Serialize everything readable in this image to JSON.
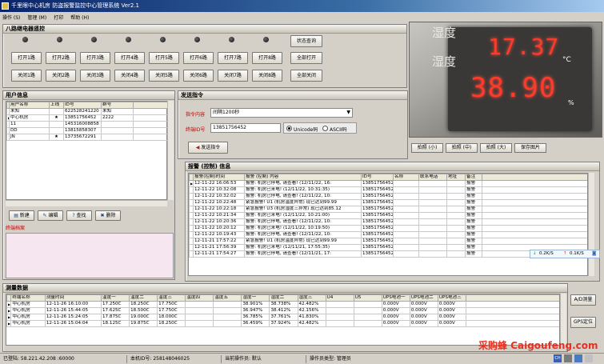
{
  "window": {
    "title": "千里眼中心机房 防盗报警监控中心管理系统 Ver2.1"
  },
  "menu": [
    "操作 (S)",
    "管理 (M)",
    "打印",
    "帮助 (H)"
  ],
  "relay": {
    "title": "八路继电器遥控",
    "open_buttons": [
      "打开1路",
      "打开2路",
      "打开3路",
      "打开4路",
      "打开5路",
      "打开6路",
      "打开7路",
      "打开8路"
    ],
    "close_buttons": [
      "关闭1路",
      "关闭2路",
      "关闭3路",
      "关闭4路",
      "关闭5路",
      "关闭6路",
      "关闭7路",
      "关闭8路"
    ],
    "status_query": "状态查询",
    "open_all": "全部打开",
    "close_all": "全部关闭"
  },
  "camera": {
    "screen_label_1": "湿度",
    "screen_label_2": "湿度",
    "value_1": "17.37",
    "unit_1": "°C",
    "value_2": "38.90",
    "unit_2": "%",
    "buttons": [
      "拍照 (小)",
      "拍照 (中)",
      "拍照 (大)",
      "保存图片"
    ]
  },
  "users": {
    "title": "用户信息",
    "columns": [
      "用户名称",
      "上线",
      "ID号",
      "群号"
    ],
    "rows": [
      [
        "未知",
        "",
        "622528241220",
        "未知"
      ],
      [
        "中心机房",
        "★",
        "13851756452",
        "2222"
      ],
      [
        "11",
        "",
        "145316008858",
        ""
      ],
      [
        "DD",
        "",
        "13815858307",
        ""
      ],
      [
        "JN",
        "★",
        "13735672291",
        ""
      ]
    ],
    "buttons": [
      "新建",
      "编辑",
      "查找",
      "删除"
    ],
    "archive_label": "终端档案"
  },
  "send": {
    "title": "发送指令",
    "cmd_label": "指令内容",
    "cmd_value": "间隔1200秒",
    "terminal_label": "终端ID号",
    "terminal_value": "13851756452",
    "radio_unicode": "Unicode码",
    "radio_ascii": "ASCII码",
    "send_button": "发送指令"
  },
  "alarms": {
    "title": "报警 (控制) 信息",
    "columns": [
      "报警(控制)时间",
      "报警 (控制) 内容",
      "ID号",
      "名称",
      "联系电话",
      "地址",
      "备注"
    ],
    "rows": [
      [
        "12-11-22 16:06:53",
        "报警: 机房已停电, 请查看!   (12/11/22, 16:",
        "13851756452",
        "",
        "",
        "",
        "报警"
      ],
      [
        "12-11-22 10:32:08",
        "报警: 机房已来电!    (12/11/22, 10:31:35)",
        "13851756452",
        "",
        "",
        "",
        "报警"
      ],
      [
        "12-11-22 10:32:02",
        "报警: 机房已停电, 请查看!   (12/11/22, 10:",
        "13851756452",
        "",
        "",
        "",
        "报警"
      ],
      [
        "12-11-22 10:22:48",
        "紧急报警! U1 (机房温度异常) 现已达到99.99",
        "13851756452",
        "",
        "",
        "",
        "报警"
      ],
      [
        "12-11-22 10:22:18",
        "紧急报警! U3 (机房湿度三异常) 现已达到85.12",
        "13851756452",
        "",
        "",
        "",
        "报警"
      ],
      [
        "12-11-22 10:21:34",
        "报警: 机房已来电!    (12/11/22, 10:21:00)",
        "13851756452",
        "",
        "",
        "",
        "报警"
      ],
      [
        "12-11-22 10:20:36",
        "报警: 机房已停电, 请查看!   (12/11/22, 10:",
        "13851756452",
        "",
        "",
        "",
        "报警"
      ],
      [
        "12-11-22 10:20:12",
        "报警: 机房已来电!    (12/11/22, 10:19:50)",
        "13851756452",
        "",
        "",
        "",
        "报警"
      ],
      [
        "12-11-22 10:19:43",
        "报警: 机房已停电, 请查看!   (12/11/22, 10:",
        "13851756452",
        "",
        "",
        "",
        "报警"
      ],
      [
        "12-11-21 17:57:22",
        "紧急报警! U1 (机房温度异常) 现已达到99.99",
        "13851756452",
        "",
        "",
        "",
        "报警"
      ],
      [
        "12-11-21 17:56:39",
        "报警: 机房已来电!    (12/11/21, 17:55:35)",
        "13851756452",
        "",
        "",
        "",
        "报警"
      ],
      [
        "12-11-21 17:54:27",
        "报警: 机房已停电, 请查看!   (12/11/21, 17:",
        "13851756452",
        "",
        "",
        "",
        "报警"
      ]
    ]
  },
  "network": {
    "down": "0.2K/S",
    "up": "0.1K/S"
  },
  "measure": {
    "title": "测量数据",
    "columns": [
      "终端名称",
      "测量时间",
      "温度一",
      "温度二",
      "温度三",
      "温度四",
      "温度五",
      "湿度一",
      "湿度二",
      "湿度三",
      "U4",
      "U5",
      "UPS电池一",
      "UPS电池二",
      "UPS电池三"
    ],
    "rows": [
      [
        "中心机房",
        "12-11-26 16:10:00",
        "17.250C",
        "18.250C",
        "17.750C",
        "",
        "",
        "38.901%",
        "38.738%",
        "42.482%",
        "",
        "",
        "0.000V",
        "0.000V",
        "0.000V"
      ],
      [
        "中心机房",
        "12-11-26 15:44:05",
        "17.625C",
        "18.500C",
        "17.750C",
        "",
        "",
        "36.947%",
        "38.412%",
        "42.156%",
        "",
        "",
        "0.000V",
        "0.000V",
        "0.000V"
      ],
      [
        "中心机房",
        "12-11-26 15:24:05",
        "17.875C",
        "19.000C",
        "18.000C",
        "",
        "",
        "36.785%",
        "37.761%",
        "41.830%",
        "",
        "",
        "0.000V",
        "0.000V",
        "0.000V"
      ],
      [
        "中心机房",
        "12-11-26 15:04:04",
        "18.125C",
        "19.875C",
        "18.250C",
        "",
        "",
        "36.459%",
        "37.924%",
        "42.482%",
        "",
        "",
        "0.000V",
        "0.000V",
        "0.000V"
      ]
    ],
    "ad_button": "A/D测量",
    "gps_button": "GPS定位"
  },
  "status": {
    "ip": "已登陆: 58.221.42.208 :60000",
    "machine": "本机ID号: 258148046025",
    "operator": "当前操作员: 默认",
    "role": "操作员类型: 管理员"
  },
  "watermark": "采购蜂 Caigoufeng.com"
}
